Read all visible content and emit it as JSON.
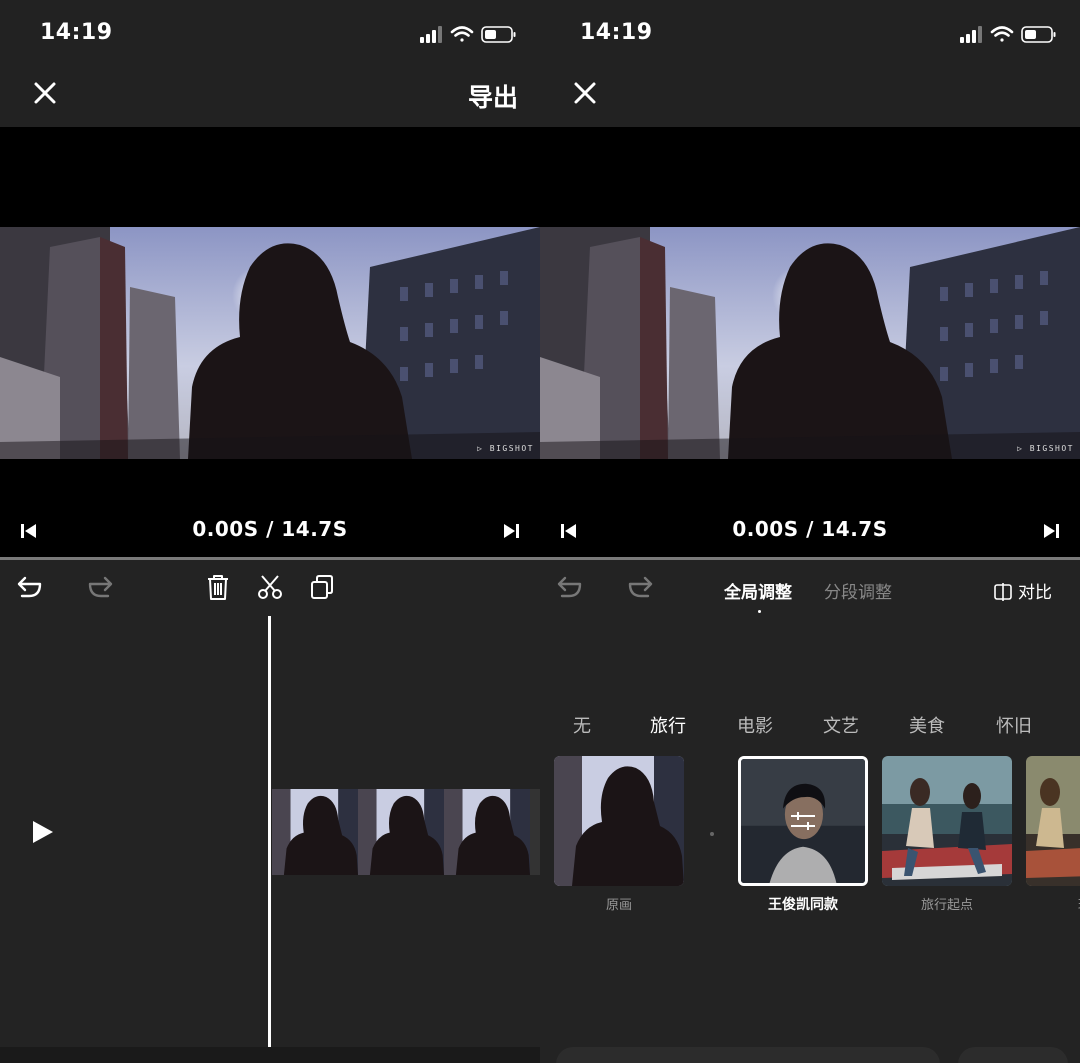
{
  "left": {
    "status": {
      "time": "14:19"
    },
    "topbar": {
      "export_label": "导出"
    },
    "video": {
      "watermark": "BIGSHOT"
    },
    "playback": {
      "time": "0.00S / 14.7S"
    }
  },
  "right": {
    "status": {
      "time": "14:19"
    },
    "video": {
      "watermark": "BIGSHOT"
    },
    "playback": {
      "time": "0.00S / 14.7S"
    },
    "tabs": [
      {
        "label": "全局调整",
        "active": true
      },
      {
        "label": "分段调整",
        "active": false
      }
    ],
    "compare_label": "对比",
    "categories": [
      "无",
      "旅行",
      "电影",
      "文艺",
      "美食",
      "怀旧"
    ],
    "active_category": "旅行",
    "filters": [
      {
        "label": "原画"
      },
      {
        "label": "王俊凯同款",
        "selected": true
      },
      {
        "label": "旅行起点"
      },
      {
        "label": "玫瑰"
      }
    ]
  },
  "colors": {
    "panel": "#232323",
    "statusbar": "#222222",
    "selected_border": "#ffffff"
  }
}
